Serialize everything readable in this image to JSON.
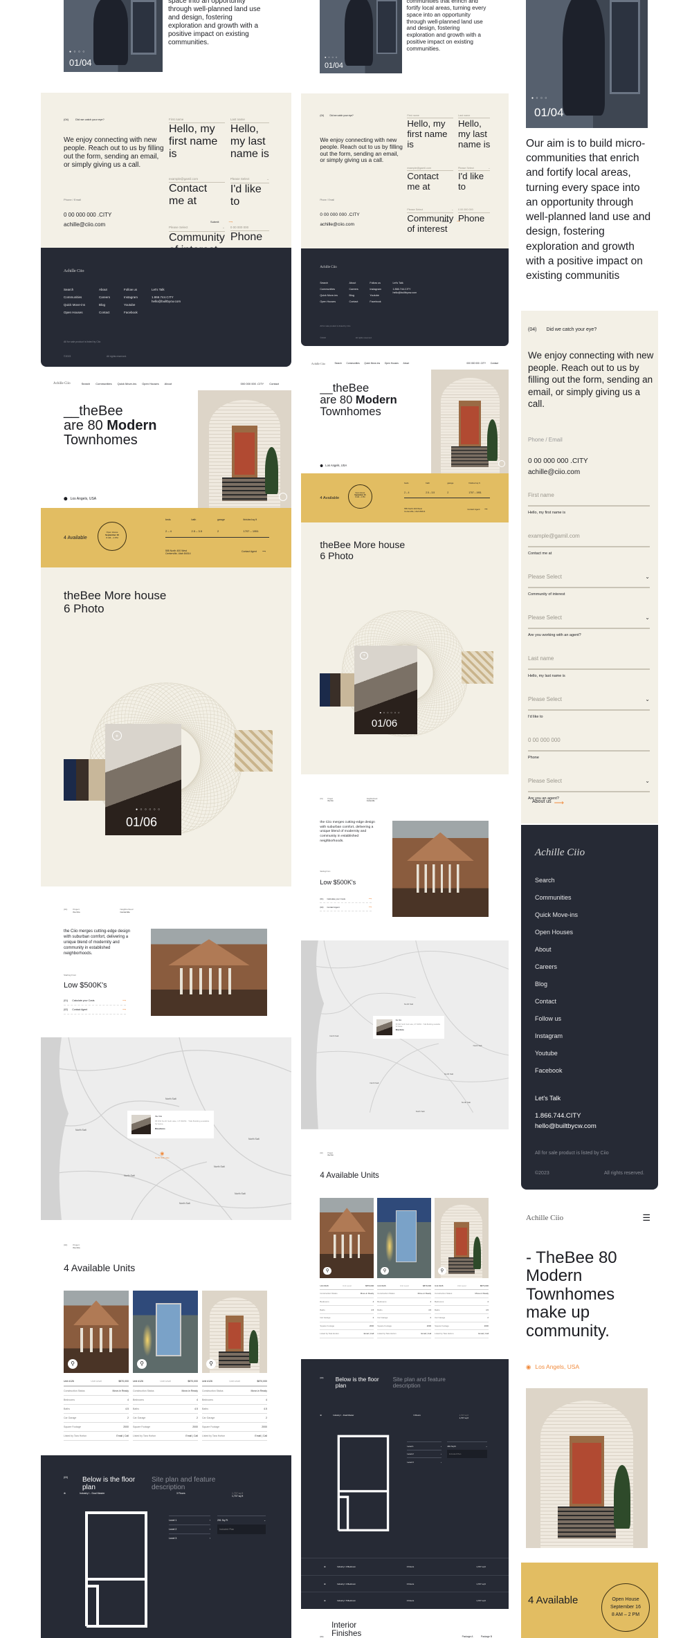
{
  "about": {
    "text": "Our aim is to build micro-communities that enrich and fortify local areas, turning every space into an opportunity through well-planned land use and design, fostering exploration and growth with a positive impact on existing communities.",
    "text_mobile": "Our aim is to build micro-communities that enrich and fortify local areas, turning every space into an opportunity through well-planned land use and design, fostering exploration and growth with a positive impact on existing communitis",
    "counter": "01/04"
  },
  "contact": {
    "number": "(04)",
    "question": "Did we catch your eye?",
    "intro": "We enjoy connecting with new people. Reach out to us by filling out the form, sending an email, or simply giving us a call.",
    "phone_label": "Phone / Email",
    "phone": "0 00 000 000 .CITY",
    "email": "achille@ciio.com",
    "fields": [
      {
        "placeholder": "First name",
        "note": "Hello, my first name is",
        "select": false
      },
      {
        "placeholder": "example@gamil.com",
        "note": "Contact me at",
        "select": false
      },
      {
        "placeholder": "Please Select",
        "note": "Community of interest",
        "select": true
      },
      {
        "placeholder": "Please Select",
        "note": "Are you working with an agent?",
        "select": true
      },
      {
        "placeholder": "Last name",
        "note": "Hello, my last name is",
        "select": false
      },
      {
        "placeholder": "Please Select",
        "note": "I'd like to",
        "select": true
      },
      {
        "placeholder": "0 00 000 000",
        "note": "Phone",
        "select": false
      },
      {
        "placeholder": "Please Select",
        "note": "Are you an agent?",
        "select": true
      }
    ],
    "submit": "Submit",
    "about_link": "About us"
  },
  "footer": {
    "logo": "Achille Ciio",
    "columns": [
      [
        "Search",
        "Communities",
        "Quick Move-ins",
        "Open Houses"
      ],
      [
        "About",
        "Careers",
        "Blog",
        "Contact"
      ],
      [
        "Follow us",
        "Instagram",
        "Youtube",
        "Facebook"
      ]
    ],
    "talk_label": "Let's Talk",
    "phone": "1.866.744.CITY",
    "email": "hello@builtbycw.com",
    "legal": "All for sale product is listed by Ciio",
    "copyright": "©2023",
    "rights": "All rights reserved."
  },
  "nav": {
    "logo": "Achille Ciio",
    "items": [
      "Search",
      "Communities",
      "Quick Move-ins",
      "Open Houses",
      "About"
    ],
    "phone": "000 000 000 .CITY",
    "contact": "Contact"
  },
  "hero": {
    "line1": "__theBee",
    "line2_a": "are 80 ",
    "line2_b": "Modern",
    "line3": "Townhomes",
    "location": "Los Angels, USA",
    "mobile_title": "- TheBee 80 Modern Townhomes make up community."
  },
  "band": {
    "available": "4 Available",
    "open_house": "Open House",
    "date": "September 16",
    "time": "8 AM – 2 PM",
    "specs": [
      {
        "label": "beds",
        "value": "2 – 4"
      },
      {
        "label": "bath",
        "value": "2.5 – 3.5"
      },
      {
        "label": "garage",
        "value": "2"
      },
      {
        "label": "finished sq ft",
        "value": "1707 – 1951"
      }
    ],
    "address1": "555 North 400 West",
    "address2": "Centerville, Utah 84014",
    "contact_agent": "Contact Agent"
  },
  "gallery": {
    "title": "theBee More house 6 Photo",
    "counter": "01/06"
  },
  "project": {
    "number": "(01)",
    "project_label": "Project",
    "project_name": "the Ciio",
    "neighborhood_label": "Neighborhood",
    "neighborhood": "Centerville",
    "description": "the Ciio merges cutting-edge design with suburban comfort, delivering a unique blend of modernity and community in established neighborhoods.",
    "starting_label": "Starting From",
    "price": "Low $500K's",
    "actions": [
      {
        "num": "(01)",
        "label": "Calculate your Costs"
      },
      {
        "num": "(02)",
        "label": "Contact Agent"
      }
    ]
  },
  "map": {
    "region_label": "North Salt",
    "pin_label": "North Salt Lake",
    "card_name": "the Ciio",
    "card_address": "95 NW North Salt Lake, UT 84054 · THE Building available for lease.",
    "directions": "Directions"
  },
  "units": {
    "number": "(02)",
    "project_label": "Project",
    "project_name": "the Ciio",
    "title": "4 Available Units",
    "items": [
      {
        "unit": "Unit #126",
        "level": "Unit Level",
        "price": "$870,000",
        "photo": "victorian"
      },
      {
        "unit": "Unit #126",
        "level": "Unit Level",
        "price": "$870,000",
        "photo": "modern"
      },
      {
        "unit": "Unit #126",
        "level": "Unit Level",
        "price": "$870,000",
        "photo": "house"
      }
    ],
    "rows": [
      {
        "label": "Construction Status",
        "value": "Move-in Ready"
      },
      {
        "label": "Bedrooms",
        "value": "4"
      },
      {
        "label": "Baths",
        "value": "4.5"
      },
      {
        "label": "Car Garage",
        "value": "2"
      },
      {
        "label": "Square Footage",
        "value": "2000"
      },
      {
        "label": "Listed by Tara Horton",
        "value": "Email | Call"
      }
    ]
  },
  "floorplan": {
    "number": "(03)",
    "title": "Below is the floor plan",
    "subtitle": "Site plan and feature description",
    "plan_name": "Industry I - Dual Master",
    "floors": "3 Floors",
    "total_label": "Total",
    "total": "1,707 sq ft",
    "levels": [
      "Level 1",
      "Level 2",
      "Level 3"
    ],
    "select": "291 Sq Ft",
    "included": "Included Plan",
    "rows": [
      {
        "name": "Industry I 3 Bedroom",
        "floors": "3 Floors",
        "sqft": "1,707 sq ft"
      },
      {
        "name": "Industry I 4 Bedroom",
        "floors": "3 Floors",
        "sqft": "1,707 sq ft"
      },
      {
        "name": "Industry I 5 Bedroom",
        "floors": "3 Floors",
        "sqft": "1,707 sq ft"
      }
    ]
  },
  "interior": {
    "number": "(04)",
    "title": "Interior Finishes",
    "packages": [
      "Package A",
      "Package B"
    ]
  },
  "colors": {
    "beige": "#f3f0e6",
    "dark": "#262a35",
    "yellow": "#e2bd62",
    "accent": "#f08a3c"
  }
}
